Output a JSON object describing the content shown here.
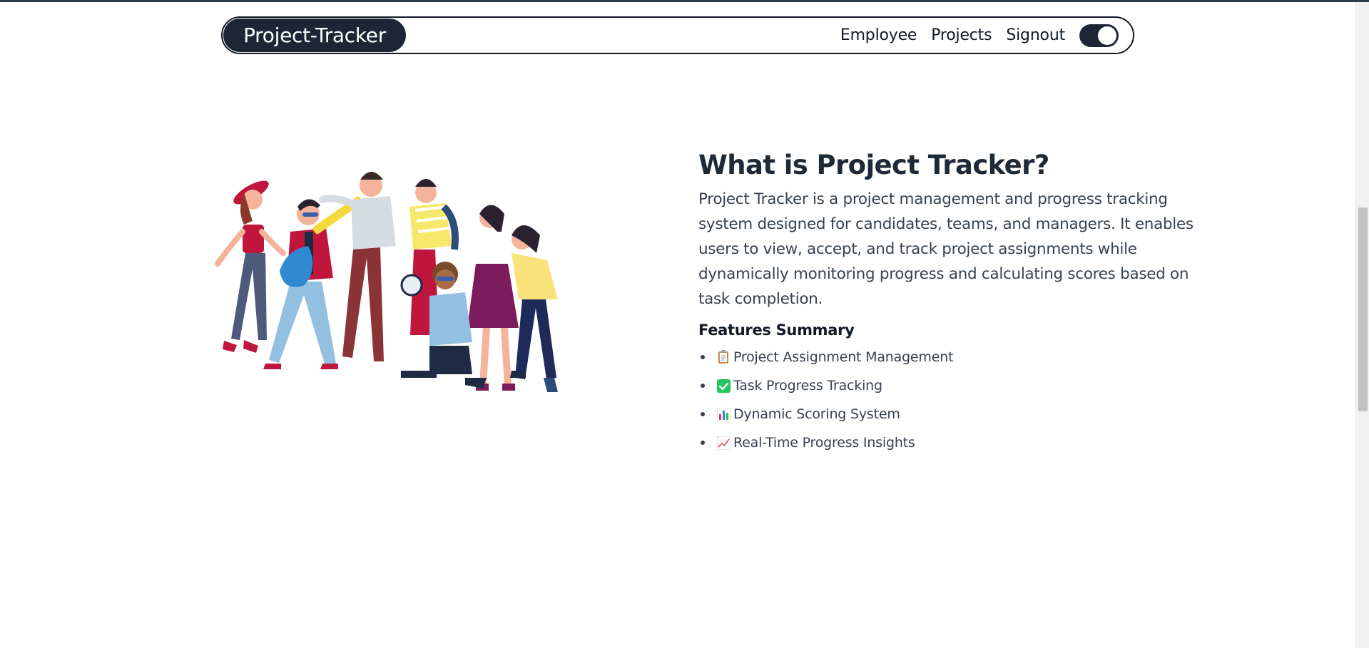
{
  "nav": {
    "brand": "Project-Tracker",
    "links": [
      "Employee",
      "Projects",
      "Signout"
    ],
    "theme_toggle_on": true
  },
  "main": {
    "heading": "What is Project Tracker?",
    "description": "Project Tracker is a project management and progress tracking system designed for candidates, teams, and managers. It enables users to view, accept, and track project assignments while dynamically monitoring progress and calculating scores based on task completion.",
    "features_title": "Features Summary",
    "features": [
      {
        "icon": "clipboard-icon",
        "label": "Project Assignment Management"
      },
      {
        "icon": "check-mark-icon",
        "label": "Task Progress Tracking"
      },
      {
        "icon": "bar-chart-icon",
        "label": "Dynamic Scoring System"
      },
      {
        "icon": "chart-increasing-icon",
        "label": "Real-Time Progress Insights"
      }
    ]
  },
  "colors": {
    "navy": "#1e2535",
    "text": "#374151",
    "check_green": "#22c55e"
  }
}
